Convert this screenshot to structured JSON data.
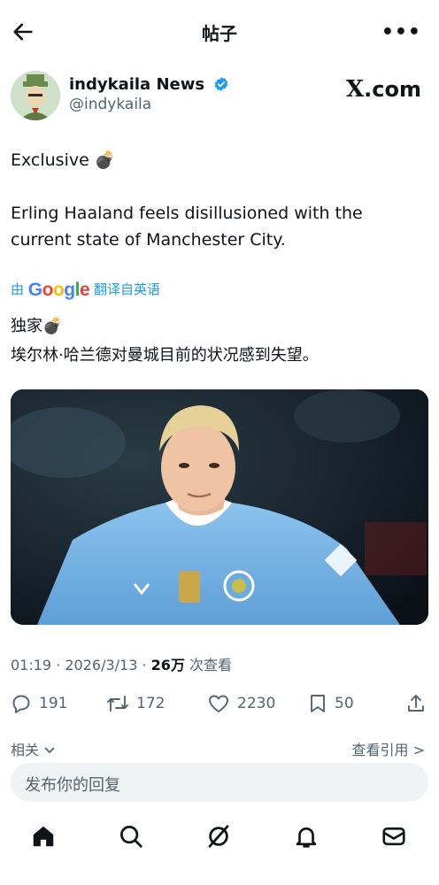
{
  "header": {
    "title": "帖子",
    "more": "•••"
  },
  "author": {
    "name": "indykaila News",
    "handle": "@indykaila"
  },
  "source": {
    "brand": "X",
    "tld": ".com"
  },
  "post": {
    "line1": "Exclusive 💣",
    "line2": "Erling Haaland feels disillusioned with the current state of Manchester City."
  },
  "translation": {
    "prefix": "由",
    "g1": "G",
    "g2": "o",
    "g3": "o",
    "g4": "g",
    "g5": "l",
    "g6": "e",
    "suffix": "翻译自英语",
    "line1": "独家💣",
    "line2": "埃尔林·哈兰德对曼城目前的状况感到失望。"
  },
  "meta": {
    "time": "01:19 · 2026/3/13 · ",
    "views": "26万",
    "views_label": " 次查看"
  },
  "actions": {
    "replies": "191",
    "reposts": "172",
    "likes": "2230",
    "bookmarks": "50"
  },
  "related": {
    "label": "相关",
    "quotes": "查看引用 >"
  },
  "reply": {
    "placeholder": "发布你的回复"
  },
  "colors": {
    "accent": "#1d9bf0",
    "text": "#0f1419",
    "muted": "#536471",
    "city_blue": "#7fb4e4"
  },
  "icons": [
    "back-arrow-icon",
    "more-icon",
    "verified-icon",
    "reply-icon",
    "repost-icon",
    "like-icon",
    "bookmark-icon",
    "share-icon",
    "chevron-down-icon",
    "home-icon",
    "search-icon",
    "grok-icon",
    "notifications-icon",
    "messages-icon"
  ]
}
